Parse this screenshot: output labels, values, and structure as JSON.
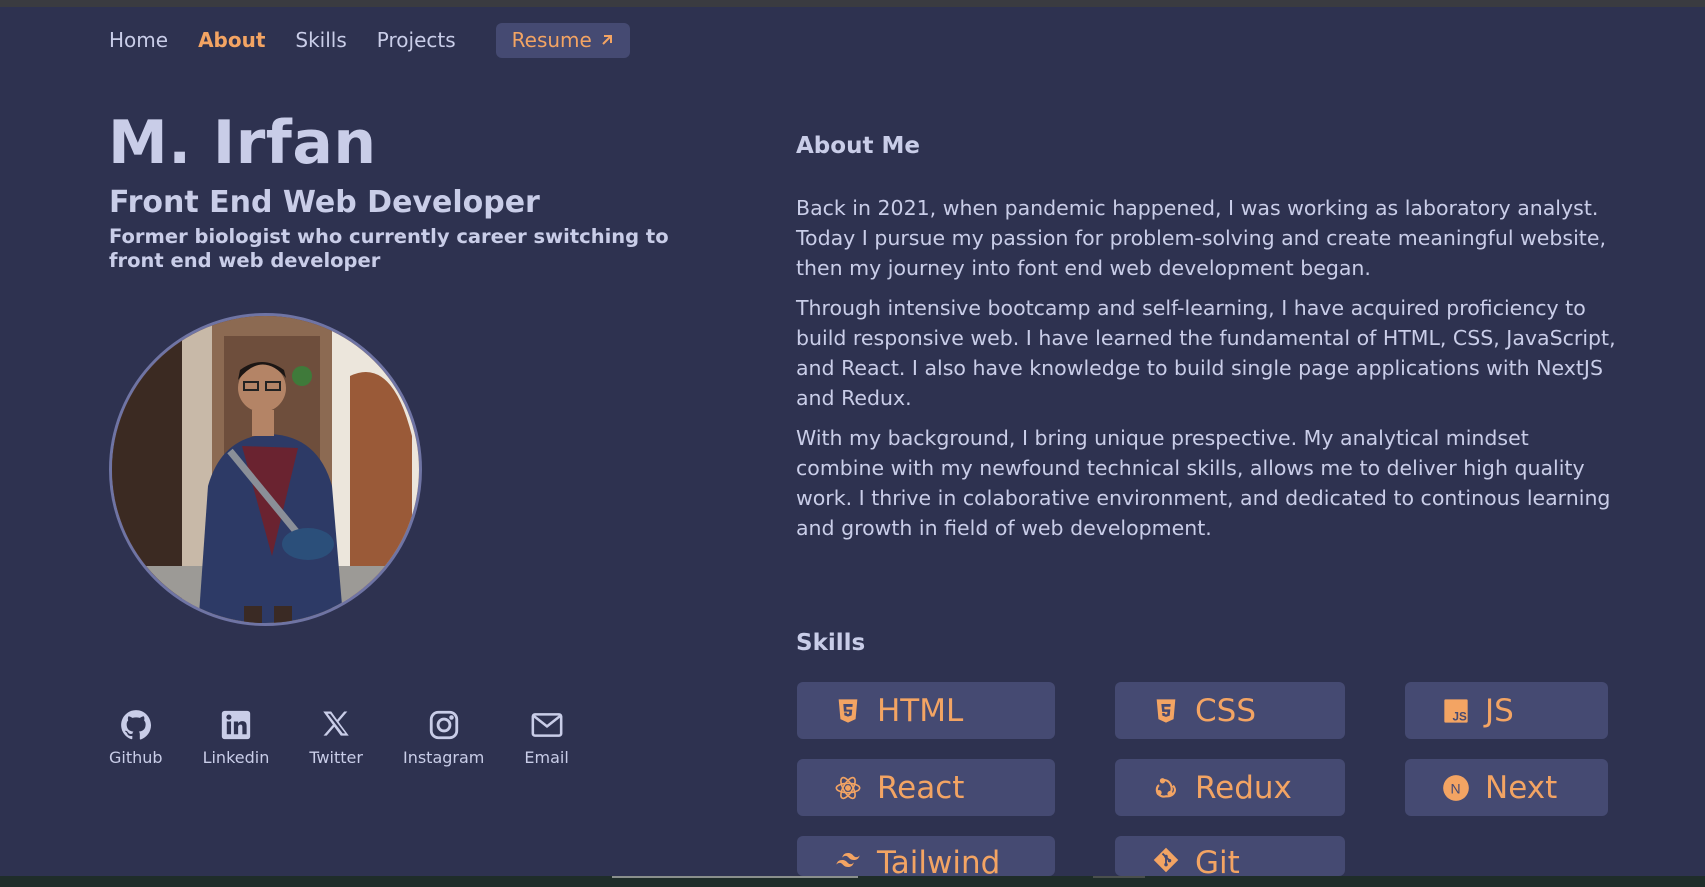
{
  "nav": {
    "items": [
      {
        "label": "Home",
        "active": false
      },
      {
        "label": "About",
        "active": true
      },
      {
        "label": "Skills",
        "active": false
      },
      {
        "label": "Projects",
        "active": false
      }
    ],
    "resume_label": "Resume",
    "resume_icon": "arrow-up-right-icon"
  },
  "hero": {
    "name": "M. Irfan",
    "role": "Front End Web Developer",
    "tagline": "Former biologist who currently career switching to front end web developer"
  },
  "socials": [
    {
      "label": "Github",
      "icon": "github-icon"
    },
    {
      "label": "Linkedin",
      "icon": "linkedin-icon"
    },
    {
      "label": "Twitter",
      "icon": "x-twitter-icon"
    },
    {
      "label": "Instagram",
      "icon": "instagram-icon"
    },
    {
      "label": "Email",
      "icon": "mail-icon"
    }
  ],
  "about": {
    "title": "About Me",
    "paragraphs": [
      "Back in 2021, when pandemic happened, I was working as laboratory analyst. Today I pursue my passion for problem-solving and create meaningful website, then my journey into font end web development began.",
      "Through intensive bootcamp and self-learning, I have acquired proficiency to build responsive web. I have learned the fundamental of HTML, CSS, JavaScript, and React. I also have knowledge to build single page applications with NextJS and Redux.",
      "With my background, I bring unique prespective. My analytical mindset combine with my newfound technical skills, allows me to deliver high quality work. I thrive in colaborative environment, and dedicated to continous learning and growth in field of web development."
    ]
  },
  "skills": {
    "title": "Skills",
    "items": [
      {
        "label": "HTML",
        "icon": "html5-icon"
      },
      {
        "label": "CSS",
        "icon": "css3-icon"
      },
      {
        "label": "JS",
        "icon": "javascript-icon"
      },
      {
        "label": "React",
        "icon": "react-icon"
      },
      {
        "label": "Redux",
        "icon": "redux-icon"
      },
      {
        "label": "Next",
        "icon": "nextjs-icon"
      },
      {
        "label": "Tailwind",
        "icon": "tailwind-icon"
      },
      {
        "label": "Git",
        "icon": "git-icon"
      }
    ]
  },
  "colors": {
    "background": "#2e3250",
    "card": "#454a72",
    "accent": "#f3a463",
    "text": "#c9cde8"
  }
}
